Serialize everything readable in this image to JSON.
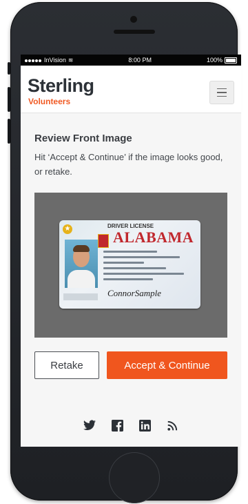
{
  "status_bar": {
    "carrier": "InVision",
    "time": "8:00 PM",
    "battery": "100%"
  },
  "header": {
    "brand": "Sterling",
    "sub_brand": "Volunteers",
    "menu_icon": "hamburger-icon"
  },
  "review": {
    "title": "Review Front Image",
    "description": "Hit ‘Accept & Continue’ if the image looks good, or retake."
  },
  "license": {
    "header": "DRIVER LICENSE",
    "state": "ALABAMA",
    "signature": "ConnorSample"
  },
  "actions": {
    "retake_label": "Retake",
    "accept_label": "Accept & Continue"
  },
  "social": [
    "twitter-icon",
    "facebook-icon",
    "linkedin-icon",
    "rss-icon"
  ],
  "colors": {
    "accent": "#f0561e",
    "text": "#3a3d42",
    "photo_bg": "#6b6b6b"
  }
}
